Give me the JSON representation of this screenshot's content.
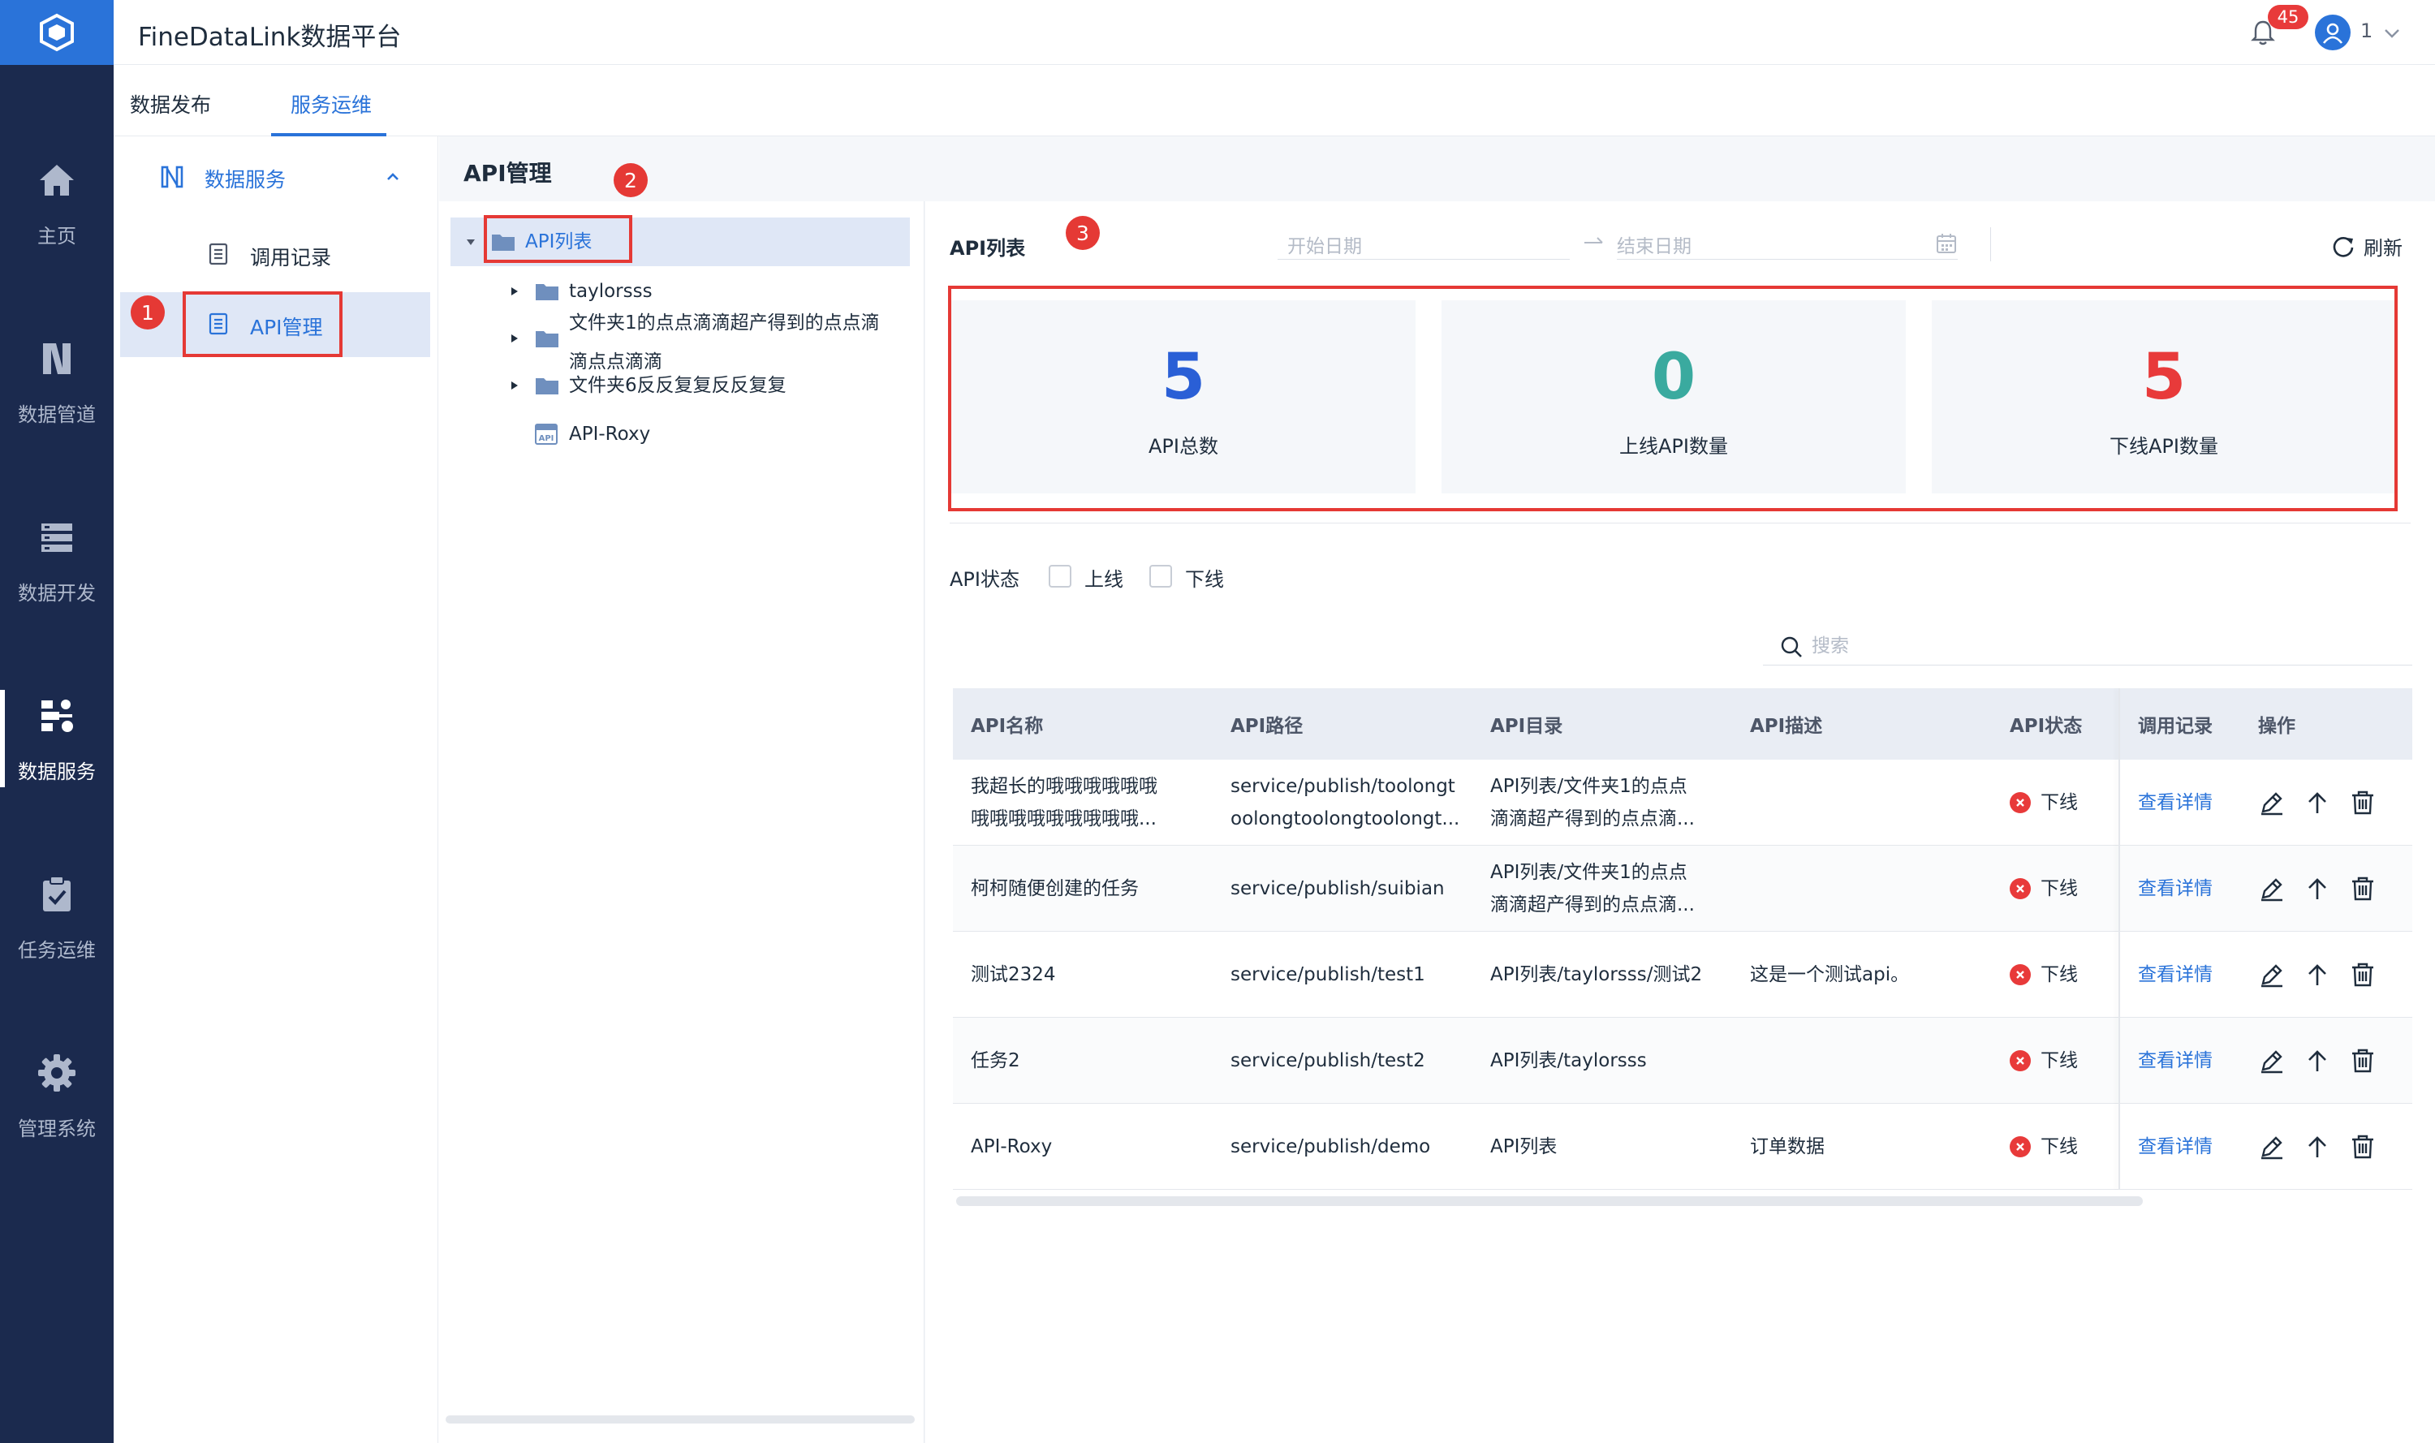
{
  "app": {
    "title": "FineDataLink数据平台"
  },
  "header": {
    "notification_count": "45",
    "user_name": "1"
  },
  "nav": {
    "items": [
      {
        "label": "主页",
        "icon": "home-icon"
      },
      {
        "label": "数据管道",
        "icon": "pipeline-icon"
      },
      {
        "label": "数据开发",
        "icon": "develop-icon"
      },
      {
        "label": "数据服务",
        "icon": "data-service-icon",
        "active": true
      },
      {
        "label": "任务运维",
        "icon": "clipboard-check-icon"
      },
      {
        "label": "管理系统",
        "icon": "gear-icon"
      }
    ]
  },
  "subtabs": [
    {
      "label": "数据发布"
    },
    {
      "label": "服务运维",
      "active": true
    }
  ],
  "service_sidebar": {
    "group_label": "数据服务",
    "items": [
      {
        "label": "调用记录"
      },
      {
        "label": "API管理",
        "active": true
      }
    ]
  },
  "annotations": [
    "1",
    "2",
    "3"
  ],
  "page": {
    "title": "API管理"
  },
  "tree": {
    "root": "API列表",
    "nodes": [
      {
        "label": "taylorsss",
        "type": "folder"
      },
      {
        "label": "文件夹1的点点滴滴超产得到的点点滴",
        "label_cont": "滴点点滴滴",
        "type": "folder"
      },
      {
        "label": "文件夹6反反复复反反复复",
        "type": "folder"
      },
      {
        "label": "API-Roxy",
        "type": "api",
        "icon_text": "API"
      }
    ]
  },
  "content": {
    "title": "API列表",
    "date_start_placeholder": "开始日期",
    "date_end_placeholder": "结束日期",
    "refresh_label": "刷新",
    "stats": [
      {
        "value": "5",
        "label": "API总数",
        "color": "#2a5fd6"
      },
      {
        "value": "0",
        "label": "上线API数量",
        "color": "#3aaa9f"
      },
      {
        "value": "5",
        "label": "下线API数量",
        "color": "#e83a3a"
      }
    ],
    "status_filter": {
      "label": "API状态",
      "options": [
        "上线",
        "下线"
      ]
    },
    "search_placeholder": "搜索"
  },
  "table": {
    "headers": [
      "API名称",
      "API路径",
      "API目录",
      "API描述",
      "API状态",
      "调用记录",
      "操作"
    ],
    "rows": [
      {
        "name_1": "我超长的哦哦哦哦哦哦",
        "name_2": "哦哦哦哦哦哦哦哦哦...",
        "path_1": "service/publish/toolongt",
        "path_2": "oolongtoolongtoolongt...",
        "dir_1": "API列表/文件夹1的点点",
        "dir_2": "滴滴超产得到的点点滴...",
        "desc": "",
        "status": "下线",
        "record": "查看详情"
      },
      {
        "name_1": "柯柯随便创建的任务",
        "name_2": "",
        "path_1": "service/publish/suibian",
        "path_2": "",
        "dir_1": "API列表/文件夹1的点点",
        "dir_2": "滴滴超产得到的点点滴...",
        "desc": "",
        "status": "下线",
        "record": "查看详情"
      },
      {
        "name_1": "测试2324",
        "name_2": "",
        "path_1": "service/publish/test1",
        "path_2": "",
        "dir_1": "API列表/taylorsss/测试2",
        "dir_2": "",
        "desc": "这是一个测试api。",
        "status": "下线",
        "record": "查看详情"
      },
      {
        "name_1": "任务2",
        "name_2": "",
        "path_1": "service/publish/test2",
        "path_2": "",
        "dir_1": "API列表/taylorsss",
        "dir_2": "",
        "desc": "",
        "status": "下线",
        "record": "查看详情"
      },
      {
        "name_1": "API-Roxy",
        "name_2": "",
        "path_1": "service/publish/demo",
        "path_2": "",
        "dir_1": "API列表",
        "dir_2": "",
        "desc": "订单数据",
        "status": "下线",
        "record": "查看详情"
      }
    ]
  },
  "colors": {
    "primary": "#2a73d9",
    "nav_bg": "#1b2a4e",
    "danger": "#e83a3a",
    "highlight_red": "#e53935"
  }
}
